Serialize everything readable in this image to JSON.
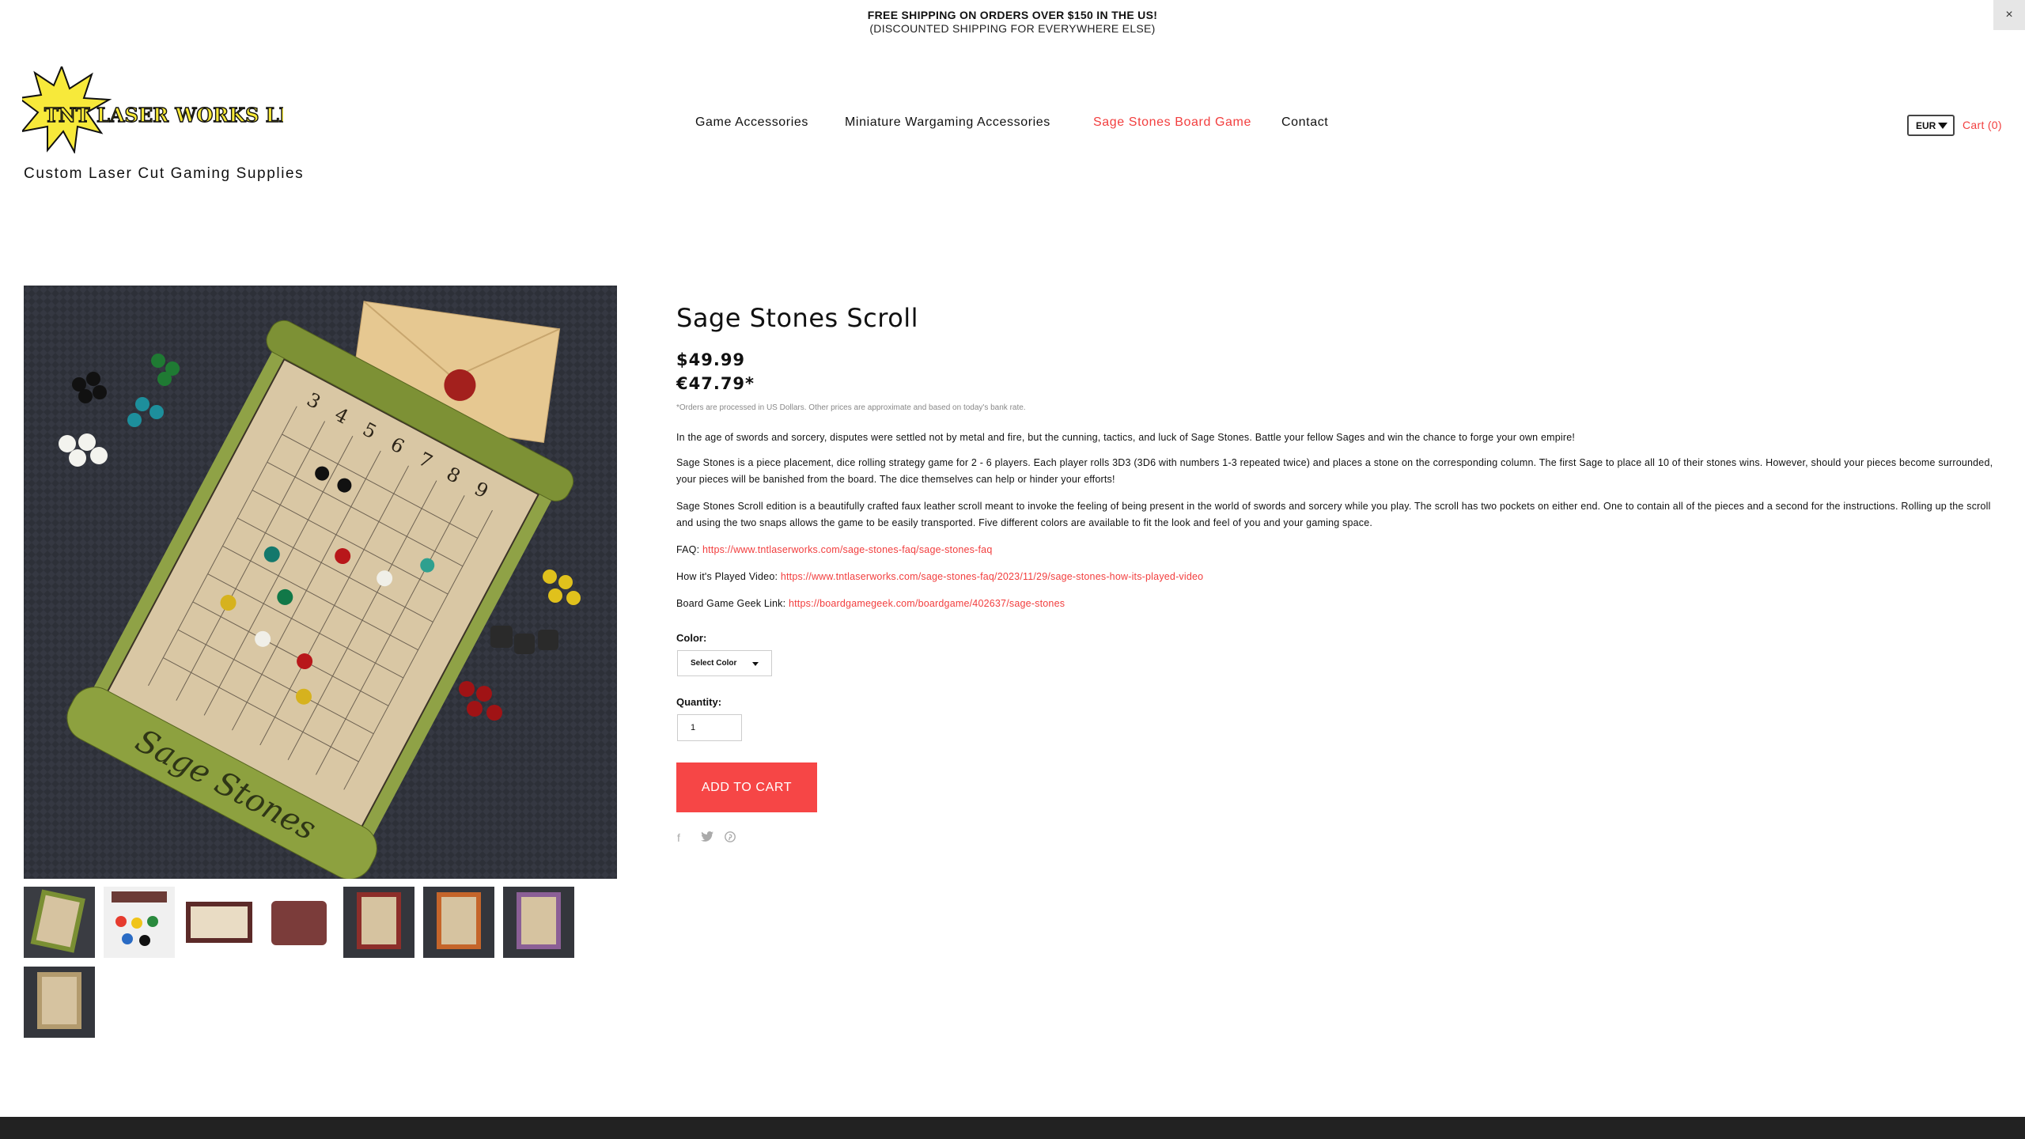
{
  "announcement": {
    "line1": "FREE SHIPPING ON ORDERS OVER $150 IN THE US!",
    "line2": "(DISCOUNTED SHIPPING FOR EVERYWHERE ELSE)",
    "close": "×"
  },
  "brand": {
    "logo_text": "TNT LASER WORKS LLC",
    "tagline": "Custom Laser Cut Gaming Supplies"
  },
  "nav": {
    "items": [
      {
        "label": "Game Accessories",
        "active": false
      },
      {
        "label": "Miniature Wargaming Accessories",
        "active": false
      },
      {
        "label": "Sage Stones Board Game",
        "active": true
      },
      {
        "label": "Contact",
        "active": false
      }
    ]
  },
  "header_right": {
    "currency": "EUR",
    "cart": "Cart (0)"
  },
  "product": {
    "title": "Sage Stones Scroll",
    "price_usd": "$49.99",
    "price_eur": "€47.79*",
    "disclaimer": "*Orders are processed in US Dollars. Other prices are approximate and based on today's bank rate.",
    "intro": "In the age of swords and sorcery, disputes were settled not by metal and fire, but the cunning, tactics, and luck of Sage Stones. Battle your fellow Sages and win the chance to forge your own empire!",
    "rules": "Sage Stones is a piece placement, dice rolling strategy game for 2 - 6 players. Each player rolls 3D3 (3D6 with numbers 1-3 repeated twice) and places a stone on the corresponding column. The first Sage to place all 10 of their stones wins. However, should your pieces become surrounded, your pieces will be banished from the board. The dice themselves can help or hinder your efforts!",
    "scroll": "Sage Stones Scroll edition is a beautifully crafted faux leather scroll meant to invoke the feeling of being present in the world of swords and sorcery while you play. The scroll has two pockets on either end. One to contain all of the pieces and a second for the instructions. Rolling up the scroll and using the two snaps allows the game to be easily transported. Five different colors are available to fit the look and feel of you and your gaming space.",
    "faq_label": "FAQ: ",
    "faq_link": "https://www.tntlaserworks.com/sage-stones-faq/sage-stones-faq",
    "video_label": "How it's Played Video: ",
    "video_link": "https://www.tntlaserworks.com/sage-stones-faq/2023/11/29/sage-stones-how-its-played-video",
    "bgg_label": "Board Game Geek Link: ",
    "bgg_link": "https://boardgamegeek.com/boardgame/402637/sage-stones",
    "color_label": "Color:",
    "color_select": "Select Color",
    "quantity_label": "Quantity:",
    "quantity_value": "1",
    "add_to_cart": "ADD TO CART",
    "share_icons": [
      "facebook-icon",
      "twitter-icon",
      "pinterest-icon"
    ]
  },
  "board_numbers": [
    "3",
    "4",
    "5",
    "6",
    "7",
    "8",
    "9"
  ],
  "scroll_brand": "Sage Stones",
  "thumbnails": [
    {
      "name": "thumb-green-scroll"
    },
    {
      "name": "thumb-stones-dice"
    },
    {
      "name": "thumb-brown-open"
    },
    {
      "name": "thumb-brown-rolled"
    },
    {
      "name": "thumb-red-scroll"
    },
    {
      "name": "thumb-orange-scroll"
    },
    {
      "name": "thumb-purple-scroll"
    },
    {
      "name": "thumb-tan-scroll"
    }
  ],
  "colors": {
    "accent": "#f23e3e",
    "button": "#f64646",
    "footer": "#222222"
  }
}
